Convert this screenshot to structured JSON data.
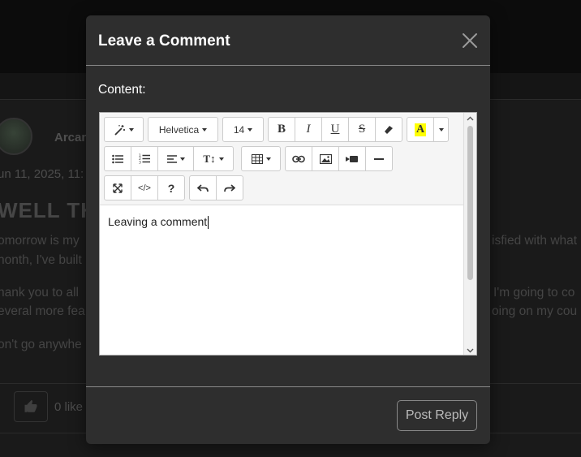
{
  "background": {
    "author": "Arcan",
    "date": "un 11, 2025, 11:",
    "title": "WELL TH",
    "paragraphs": [
      {
        "left": "omorrow is my",
        "right": "isfied with what"
      },
      {
        "left": "nonth, I've built",
        "right": ""
      },
      {
        "left": "hank you to all",
        "right": "I'm going to co"
      },
      {
        "left": "everal more fea",
        "right": "oing on my cou"
      },
      {
        "left": "on't go anywhe",
        "right": ""
      }
    ],
    "likes": "0 like"
  },
  "modal": {
    "title": "Leave a Comment",
    "content_label": "Content:",
    "post_button": "Post Reply"
  },
  "editor": {
    "font_family": "Helvetica",
    "font_size": "14",
    "content": "Leaving a comment",
    "highlight_color": "#ffff00",
    "toolbar_rows": [
      [
        "magic-style",
        "font-family",
        "font-size",
        "bold",
        "italic",
        "underline",
        "strikethrough",
        "eraser",
        "text-color"
      ],
      [
        "unordered-list",
        "ordered-list",
        "paragraph-align",
        "line-height",
        "table",
        "link",
        "picture",
        "video",
        "horizontal-rule"
      ],
      [
        "fullscreen",
        "code-view",
        "help",
        "undo",
        "redo"
      ]
    ],
    "labels": {
      "bold": "B",
      "italic": "I",
      "underline": "U",
      "strikethrough": "S",
      "text_color": "A",
      "code": "</>",
      "help": "?",
      "line_height": "T↕"
    }
  }
}
